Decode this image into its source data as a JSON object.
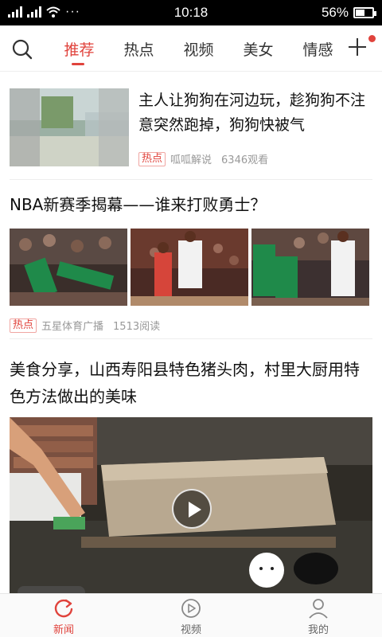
{
  "status_bar": {
    "time": "10:18",
    "battery": "56%",
    "battery_level": 0.56,
    "more_label": "···"
  },
  "top_nav": {
    "search_icon": "search-icon",
    "tabs": [
      {
        "label": "推荐",
        "active": true
      },
      {
        "label": "热点",
        "active": false
      },
      {
        "label": "视频",
        "active": false
      },
      {
        "label": "美女",
        "active": false
      },
      {
        "label": "情感",
        "active": false
      }
    ],
    "add_icon": "plus-icon"
  },
  "feed": {
    "items": [
      {
        "title": "主人让狗狗在河边玩，趁狗狗不注意突然跑掉，狗狗快被气",
        "tag": "热点",
        "source": "呱呱解说",
        "stat": "6346观看"
      },
      {
        "title": "NBA新赛季揭幕——谁来打败勇士？",
        "tag": "热点",
        "source": "五星体育广播",
        "stat": "1513阅读"
      },
      {
        "title": "美食分享，山西寿阳县特色猪头肉，村里大厨用特色方法做出的美味"
      }
    ]
  },
  "bottom_nav": [
    {
      "label": "新闻",
      "icon": "refresh-icon",
      "active": true
    },
    {
      "label": "视频",
      "icon": "play-circle-icon",
      "active": false
    },
    {
      "label": "我的",
      "icon": "person-icon",
      "active": false
    }
  ],
  "colors": {
    "accent": "#e0433c"
  }
}
